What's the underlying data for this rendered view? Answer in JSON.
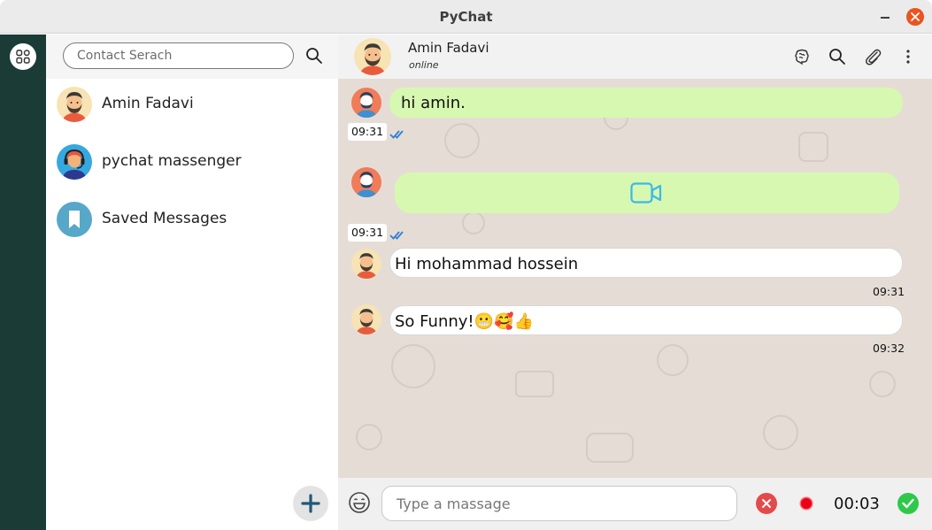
{
  "window": {
    "title": "PyChat"
  },
  "sidebar": {
    "search": {
      "placeholder": "Contact Serach"
    },
    "contacts": [
      {
        "name": "Amin Fadavi",
        "avatar": "man-beard-avatar"
      },
      {
        "name": "pychat massenger",
        "avatar": "headset-support-avatar"
      },
      {
        "name": "Saved Messages",
        "avatar": "bookmark-icon"
      }
    ],
    "add_button_icon": "plus-icon"
  },
  "chat": {
    "header": {
      "name": "Amin Fadavi",
      "status": "online"
    },
    "header_icons": [
      "brain-icon",
      "search-icon",
      "paperclip-icon",
      "more-vertical-icon"
    ],
    "messages": [
      {
        "direction": "out",
        "text": "hi amin.",
        "time": "09:31",
        "ticks": "double-check"
      },
      {
        "direction": "out",
        "type": "video",
        "icon": "video-camera-icon",
        "time": "09:31",
        "ticks": "double-check"
      },
      {
        "direction": "in",
        "text": "Hi mohammad hossein",
        "time": "09:31"
      },
      {
        "direction": "in",
        "text": "So Funny!😬🥰👍",
        "time": "09:32"
      }
    ]
  },
  "composer": {
    "placeholder": "Type a massage",
    "timer": "00:03"
  },
  "colors": {
    "rail": "#1b3b36",
    "outgoing_bubble": "#d7f8b0",
    "incoming_bubble": "#ffffff",
    "chat_bg": "#e5ddd5",
    "cancel": "#e34b4b",
    "send": "#2ec94a",
    "close_window": "#e95420",
    "ticks": "#2e7fd8"
  }
}
